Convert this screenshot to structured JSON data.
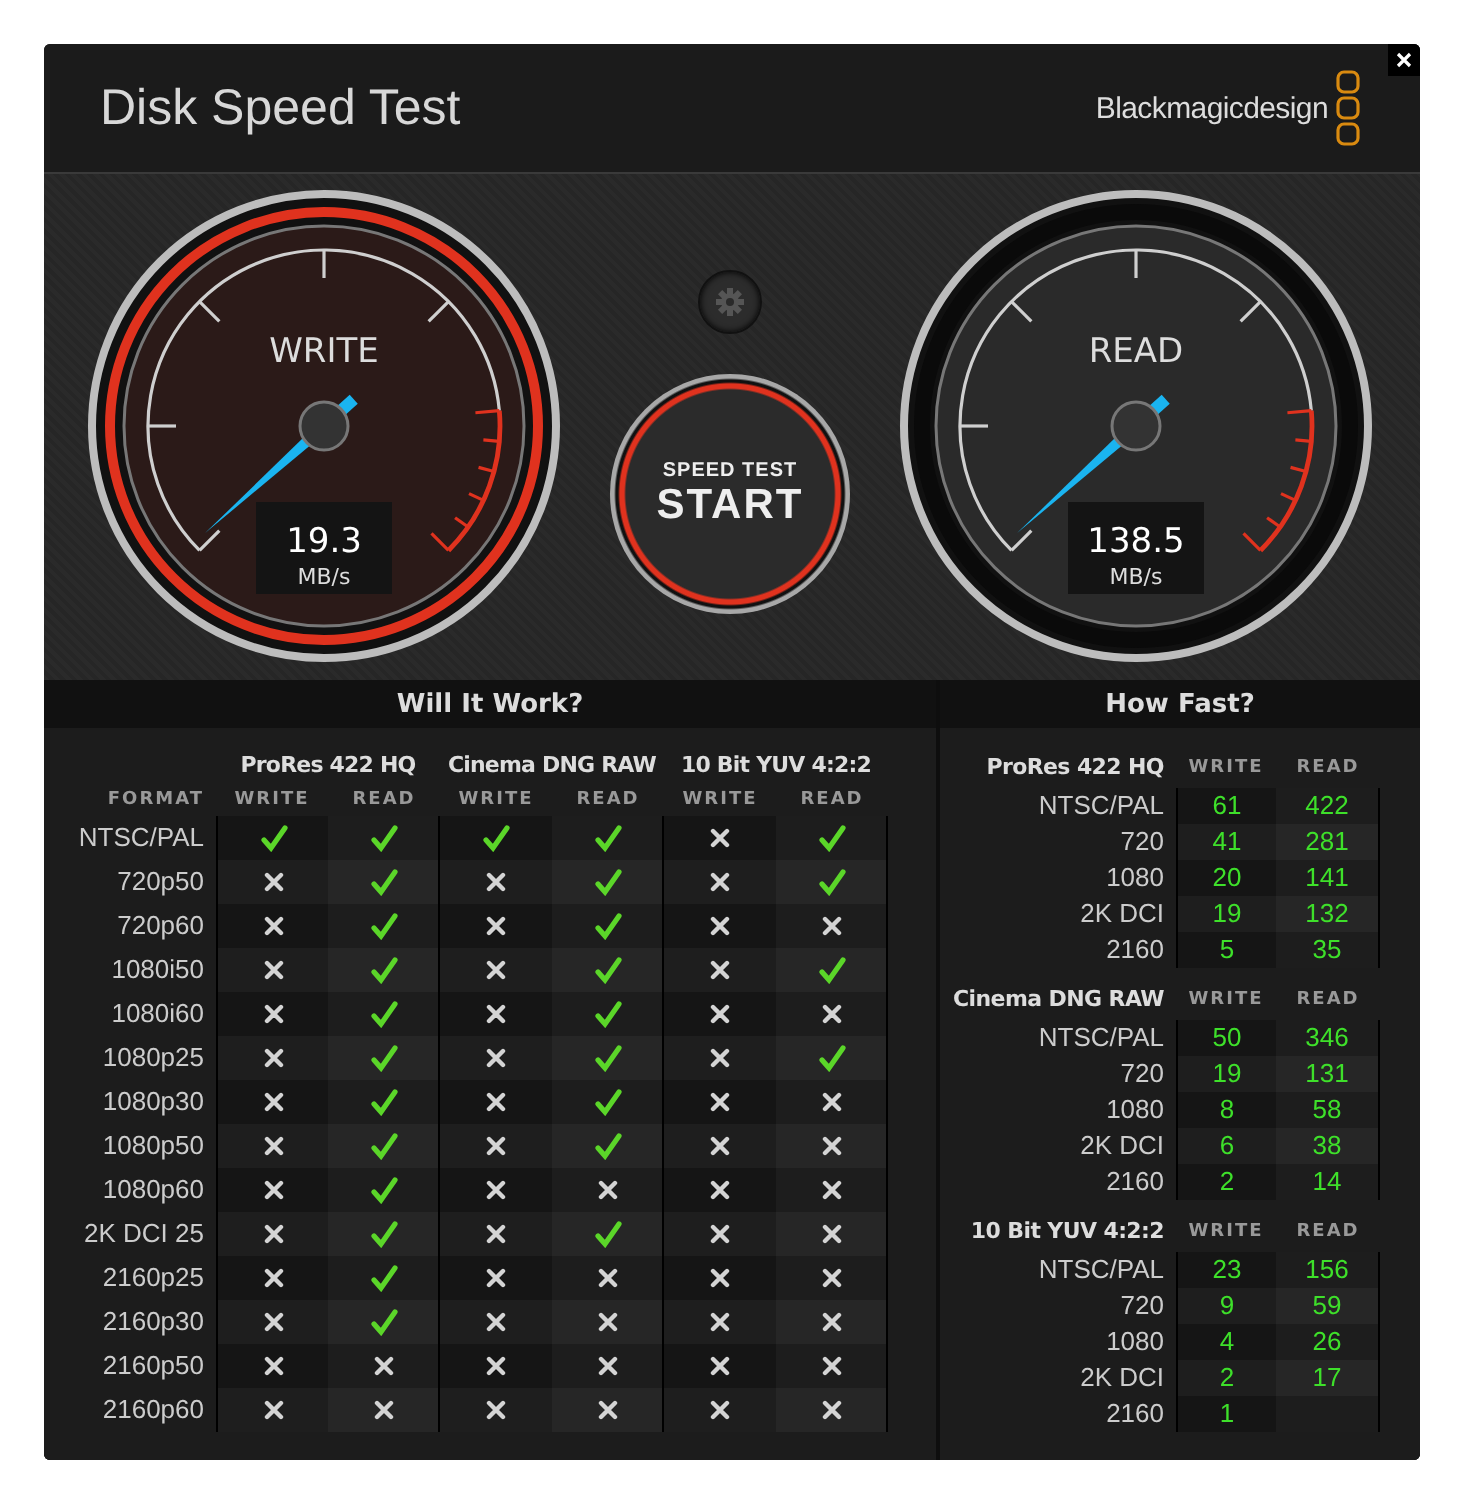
{
  "window": {
    "title": "Disk Speed Test"
  },
  "brand": {
    "name": "Blackmagicdesign"
  },
  "gauges": [
    {
      "label": "WRITE",
      "value": "19.3",
      "unit": "MB/s",
      "highlighted": true
    },
    {
      "label": "READ",
      "value": "138.5",
      "unit": "MB/s",
      "highlighted": false
    }
  ],
  "start_button": {
    "line1": "SPEED TEST",
    "line2": "START"
  },
  "will_it_work": {
    "title": "Will It Work?",
    "format_heading": "FORMAT",
    "codecs": [
      {
        "name": "ProRes 422 HQ",
        "columns": [
          "WRITE",
          "READ"
        ]
      },
      {
        "name": "Cinema DNG RAW",
        "columns": [
          "WRITE",
          "READ"
        ]
      },
      {
        "name": "10 Bit YUV 4:2:2",
        "columns": [
          "WRITE",
          "READ"
        ]
      }
    ],
    "rows": [
      {
        "format": "NTSC/PAL",
        "results": [
          true,
          true,
          true,
          true,
          false,
          true
        ]
      },
      {
        "format": "720p50",
        "results": [
          false,
          true,
          false,
          true,
          false,
          true
        ]
      },
      {
        "format": "720p60",
        "results": [
          false,
          true,
          false,
          true,
          false,
          false
        ]
      },
      {
        "format": "1080i50",
        "results": [
          false,
          true,
          false,
          true,
          false,
          true
        ]
      },
      {
        "format": "1080i60",
        "results": [
          false,
          true,
          false,
          true,
          false,
          false
        ]
      },
      {
        "format": "1080p25",
        "results": [
          false,
          true,
          false,
          true,
          false,
          true
        ]
      },
      {
        "format": "1080p30",
        "results": [
          false,
          true,
          false,
          true,
          false,
          false
        ]
      },
      {
        "format": "1080p50",
        "results": [
          false,
          true,
          false,
          true,
          false,
          false
        ]
      },
      {
        "format": "1080p60",
        "results": [
          false,
          true,
          false,
          false,
          false,
          false
        ]
      },
      {
        "format": "2K DCI 25",
        "results": [
          false,
          true,
          false,
          true,
          false,
          false
        ]
      },
      {
        "format": "2160p25",
        "results": [
          false,
          true,
          false,
          false,
          false,
          false
        ]
      },
      {
        "format": "2160p30",
        "results": [
          false,
          true,
          false,
          false,
          false,
          false
        ]
      },
      {
        "format": "2160p50",
        "results": [
          false,
          false,
          false,
          false,
          false,
          false
        ]
      },
      {
        "format": "2160p60",
        "results": [
          false,
          false,
          false,
          false,
          false,
          false
        ]
      }
    ]
  },
  "how_fast": {
    "title": "How Fast?",
    "groups": [
      {
        "codec": "ProRes 422 HQ",
        "columns": [
          "WRITE",
          "READ"
        ],
        "rows": [
          {
            "format": "NTSC/PAL",
            "write": "61",
            "read": "422"
          },
          {
            "format": "720",
            "write": "41",
            "read": "281"
          },
          {
            "format": "1080",
            "write": "20",
            "read": "141"
          },
          {
            "format": "2K DCI",
            "write": "19",
            "read": "132"
          },
          {
            "format": "2160",
            "write": "5",
            "read": "35"
          }
        ]
      },
      {
        "codec": "Cinema DNG RAW",
        "columns": [
          "WRITE",
          "READ"
        ],
        "rows": [
          {
            "format": "NTSC/PAL",
            "write": "50",
            "read": "346"
          },
          {
            "format": "720",
            "write": "19",
            "read": "131"
          },
          {
            "format": "1080",
            "write": "8",
            "read": "58"
          },
          {
            "format": "2K DCI",
            "write": "6",
            "read": "38"
          },
          {
            "format": "2160",
            "write": "2",
            "read": "14"
          }
        ]
      },
      {
        "codec": "10 Bit YUV 4:2:2",
        "columns": [
          "WRITE",
          "READ"
        ],
        "rows": [
          {
            "format": "NTSC/PAL",
            "write": "23",
            "read": "156"
          },
          {
            "format": "720",
            "write": "9",
            "read": "59"
          },
          {
            "format": "1080",
            "write": "4",
            "read": "26"
          },
          {
            "format": "2K DCI",
            "write": "2",
            "read": "17"
          },
          {
            "format": "2160",
            "write": "1"
          }
        ]
      }
    ]
  }
}
